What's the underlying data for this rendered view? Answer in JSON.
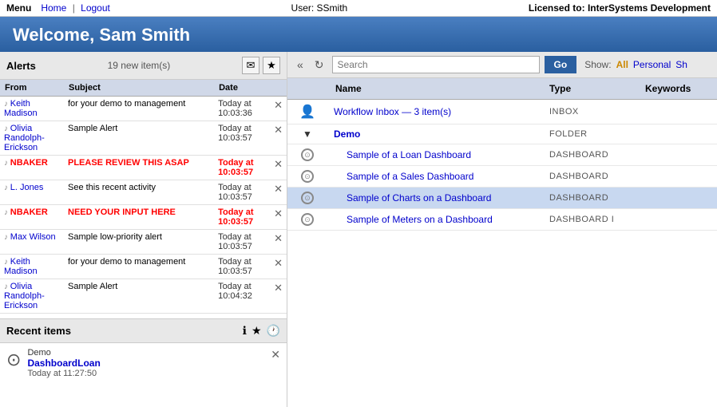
{
  "topbar": {
    "menu_label": "Menu",
    "nav_home": "Home",
    "nav_separator": "|",
    "nav_logout": "Logout",
    "user_label": "User:",
    "user_name": "SSmith",
    "license_label": "Licensed to:",
    "license_name": "InterSystems Development"
  },
  "header": {
    "title": "Welcome, Sam Smith"
  },
  "alerts": {
    "title": "Alerts",
    "count": "19 new item(s)",
    "columns": [
      "From",
      "Subject",
      "Date"
    ],
    "rows": [
      {
        "from": "Keith Madison",
        "from_red": false,
        "subject": "for your demo to management",
        "subject_red": false,
        "date": "Today at",
        "time": "10:03:36",
        "date_red": false
      },
      {
        "from": "Olivia Randolph-Erickson",
        "from_red": false,
        "subject": "Sample Alert",
        "subject_red": false,
        "date": "Today at",
        "time": "10:03:57",
        "date_red": false
      },
      {
        "from": "NBAKER",
        "from_red": true,
        "subject": "PLEASE REVIEW THIS ASAP",
        "subject_red": true,
        "date": "Today at",
        "time": "10:03:57",
        "date_red": true
      },
      {
        "from": "L. Jones",
        "from_red": false,
        "subject": "See this recent activity",
        "subject_red": false,
        "date": "Today at",
        "time": "10:03:57",
        "date_red": false
      },
      {
        "from": "NBAKER",
        "from_red": true,
        "subject": "NEED YOUR INPUT HERE",
        "subject_red": true,
        "date": "Today at",
        "time": "10:03:57",
        "date_red": true
      },
      {
        "from": "Max Wilson",
        "from_red": false,
        "subject": "Sample low-priority alert",
        "subject_red": false,
        "date": "Today at",
        "time": "10:03:57",
        "date_red": false
      },
      {
        "from": "Keith Madison",
        "from_red": false,
        "subject": "for your demo to management",
        "subject_red": false,
        "date": "Today at",
        "time": "10:03:57",
        "date_red": false
      },
      {
        "from": "Olivia Randolph-Erickson",
        "from_red": false,
        "subject": "Sample Alert",
        "subject_red": false,
        "date": "Today at",
        "time": "10:04:32",
        "date_red": false
      }
    ]
  },
  "recent": {
    "title": "Recent items",
    "item": {
      "category": "Demo",
      "name": "DashboardLoan",
      "date": "Today at 11:27:50"
    }
  },
  "toolbar": {
    "search_placeholder": "Search",
    "go_label": "Go",
    "show_label": "Show:",
    "show_all": "All",
    "show_personal": "Personal",
    "show_sh": "Sh"
  },
  "content_table": {
    "columns": [
      "Name",
      "Type",
      "Keywords"
    ],
    "rows": [
      {
        "type": "workflow",
        "name": "Workflow Inbox — 3 item(s)",
        "type_label": "Inbox",
        "indent": 0,
        "bold": false,
        "arrow": false
      },
      {
        "type": "folder-arrow",
        "name": "Demo",
        "type_label": "Folder",
        "indent": 0,
        "bold": true,
        "arrow": true
      },
      {
        "type": "dashboard",
        "name": "Sample of a Loan Dashboard",
        "type_label": "Dashboard",
        "indent": 1,
        "bold": false,
        "arrow": false
      },
      {
        "type": "dashboard",
        "name": "Sample of a Sales Dashboard",
        "type_label": "Dashboard",
        "indent": 1,
        "bold": false,
        "arrow": false
      },
      {
        "type": "dashboard",
        "name": "Sample of Charts on a Dashboard",
        "type_label": "Dashboard",
        "indent": 1,
        "bold": false,
        "arrow": false,
        "selected": true
      },
      {
        "type": "dashboard",
        "name": "Sample of Meters on a Dashboard",
        "type_label": "Dashboard I",
        "indent": 1,
        "bold": false,
        "arrow": false
      }
    ]
  }
}
